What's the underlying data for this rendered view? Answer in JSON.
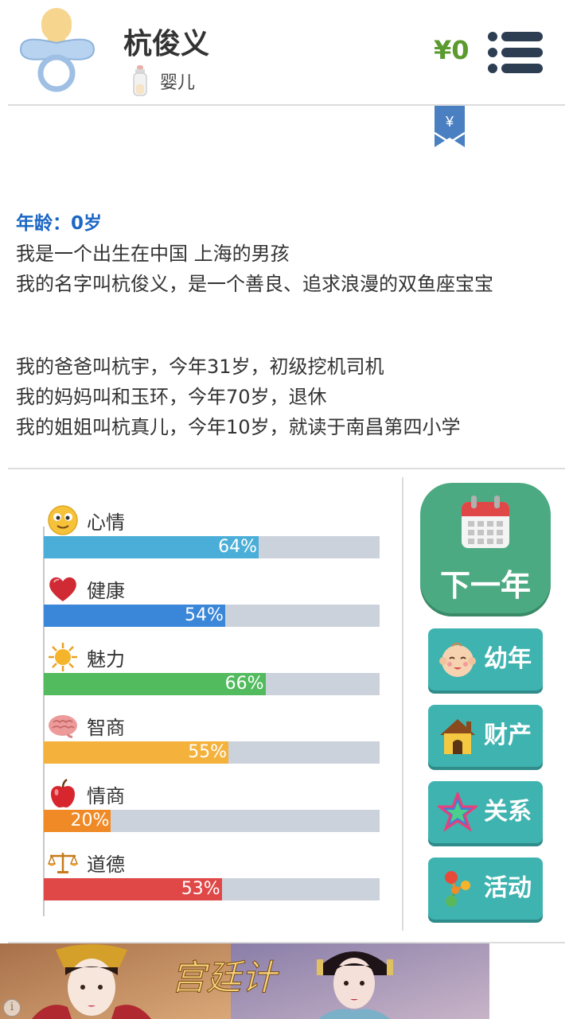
{
  "header": {
    "name": "杭俊义",
    "stage": "婴儿",
    "money": "¥0",
    "stage_icon": "pacifier-icon",
    "menu_icon": "menu-icon"
  },
  "bookmark": {
    "symbol": "¥"
  },
  "story": {
    "age": "年龄：0岁",
    "intro": [
      "我是一个出生在中国 上海的男孩",
      "我的名字叫杭俊义，是一个善良、追求浪漫的双鱼座宝宝"
    ],
    "family": [
      "我的爸爸叫杭宇，今年31岁，初级挖机司机",
      "我的妈妈叫和玉环，今年70岁，退休",
      "我的姐姐叫杭真儿，今年10岁，就读于南昌第四小学"
    ]
  },
  "stats": [
    {
      "label": "心情",
      "value": 64,
      "pct": "64%",
      "color": "#4aaed8",
      "icon": "smiley-icon"
    },
    {
      "label": "健康",
      "value": 54,
      "pct": "54%",
      "color": "#3a86d8",
      "icon": "heart-icon"
    },
    {
      "label": "魅力",
      "value": 66,
      "pct": "66%",
      "color": "#52bb5e",
      "icon": "sun-icon"
    },
    {
      "label": "智商",
      "value": 55,
      "pct": "55%",
      "color": "#f4b23c",
      "icon": "brain-icon"
    },
    {
      "label": "情商",
      "value": 20,
      "pct": "20%",
      "color": "#ef8a26",
      "icon": "apple-icon"
    },
    {
      "label": "道德",
      "value": 53,
      "pct": "53%",
      "color": "#e04848",
      "icon": "scales-icon"
    }
  ],
  "actions": {
    "next_year": "下一年",
    "buttons": [
      {
        "label": "幼年",
        "icon": "baby-face-icon"
      },
      {
        "label": "财产",
        "icon": "house-icon"
      },
      {
        "label": "关系",
        "icon": "star-icon"
      },
      {
        "label": "活动",
        "icon": "activity-icon"
      }
    ]
  },
  "ad": {
    "info_symbol": "i",
    "logo_text": "宫廷计"
  }
}
